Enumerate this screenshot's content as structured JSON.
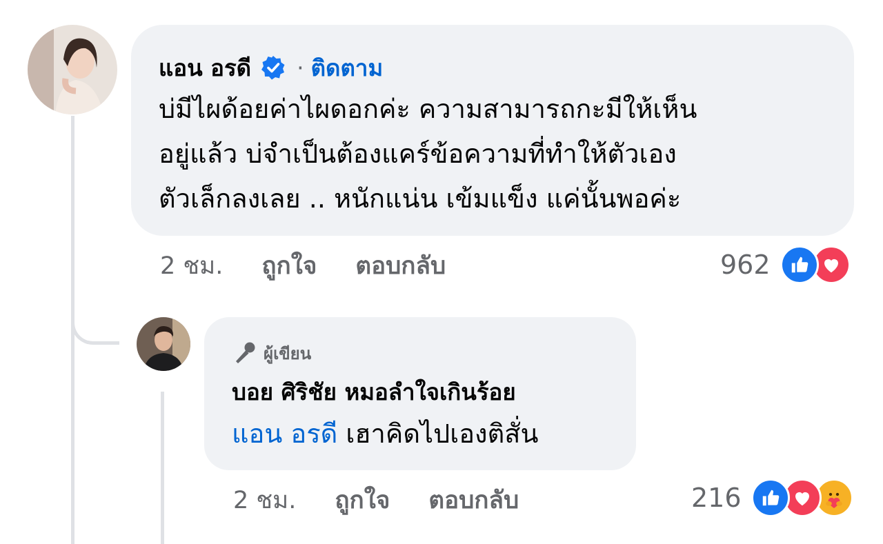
{
  "comment": {
    "author": "แอน อรดี",
    "separator": "·",
    "follow_label": "ติดตาม",
    "text": "บ่มีไผด้อยค่าไผดอกค่ะ ความสามารถกะมีให้เห็น\nอยู่แล้ว บ่จำเป็นต้องแคร์ข้อความที่ทำให้ตัวเอง\nตัวเล็กลงเลย .. หนักแน่น เข้มแข็ง แค่นั้นพอค่ะ",
    "time": "2 ชม.",
    "like_label": "ถูกใจ",
    "reply_label": "ตอบกลับ",
    "reaction_count": "962",
    "reactions": [
      "like-icon",
      "love-icon"
    ]
  },
  "reply": {
    "badge_label": "ผู้เขียน",
    "author": "บอย ศิริชัย หมอลำใจเกินร้อย",
    "mention": "แอน อรดี",
    "text": "เฮาคิดไปเองติสั่น",
    "time": "2 ชม.",
    "like_label": "ถูกใจ",
    "reply_label": "ตอบกลับ",
    "reaction_count": "216",
    "reactions": [
      "like-icon",
      "love-icon",
      "care-icon"
    ]
  },
  "colors": {
    "bubble": "#f0f2f5",
    "link": "#0064d1",
    "secondary_text": "#65676b",
    "like": "#1877f2",
    "love": "#f33e58",
    "care": "#f7b125"
  }
}
